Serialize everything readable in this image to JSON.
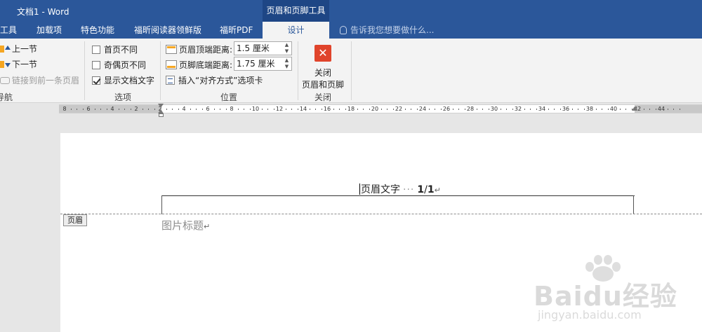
{
  "titlebar": {
    "doc_title": "文档1 - Word",
    "context_label": "页眉和页脚工具"
  },
  "tabs": [
    {
      "label": "工具",
      "active": false
    },
    {
      "label": "加载项",
      "active": false
    },
    {
      "label": "特色功能",
      "active": false
    },
    {
      "label": "福昕阅读器领鲜版",
      "active": false
    },
    {
      "label": "福昕PDF",
      "active": false
    },
    {
      "label": "设计",
      "active": true
    }
  ],
  "tell_me": "告诉我您想要做什么...",
  "ribbon": {
    "navigation": {
      "prev_section": "上一节",
      "next_section": "下一节",
      "link_previous": "链接到前一条页眉",
      "group_label": "导航"
    },
    "options": {
      "different_first_page": {
        "label": "首页不同",
        "checked": false
      },
      "different_odd_even": {
        "label": "奇偶页不同",
        "checked": false
      },
      "show_document_text": {
        "label": "显示文档文字",
        "checked": true
      },
      "group_label": "选项"
    },
    "position": {
      "header_from_top_label": "页眉顶端距离:",
      "header_from_top_value": "1.5 厘米",
      "footer_from_bottom_label": "页脚底端距离:",
      "footer_from_bottom_value": "1.75 厘米",
      "insert_alignment_tab": "插入“对齐方式”选项卡",
      "group_label": "位置"
    },
    "close": {
      "button_line1": "关闭",
      "button_line2": "页眉和页脚",
      "group_label": "关闭"
    }
  },
  "ruler": {
    "labels": [
      "8",
      "6",
      "4",
      "2",
      "2",
      "4",
      "6",
      "8",
      "10",
      "12",
      "14",
      "16",
      "18",
      "20",
      "22",
      "24",
      "26",
      "28",
      "30",
      "32",
      "34",
      "36",
      "38",
      "40",
      "42",
      "44"
    ]
  },
  "document": {
    "header_text": "页眉文字",
    "page_current": "1",
    "page_separator": "/",
    "page_total": "1",
    "paragraph_mark": "↵",
    "header_tag": "页眉",
    "caption": "图片标题"
  },
  "watermark": {
    "brand": "Baidu经验",
    "url": "jingyan.baidu.com"
  }
}
